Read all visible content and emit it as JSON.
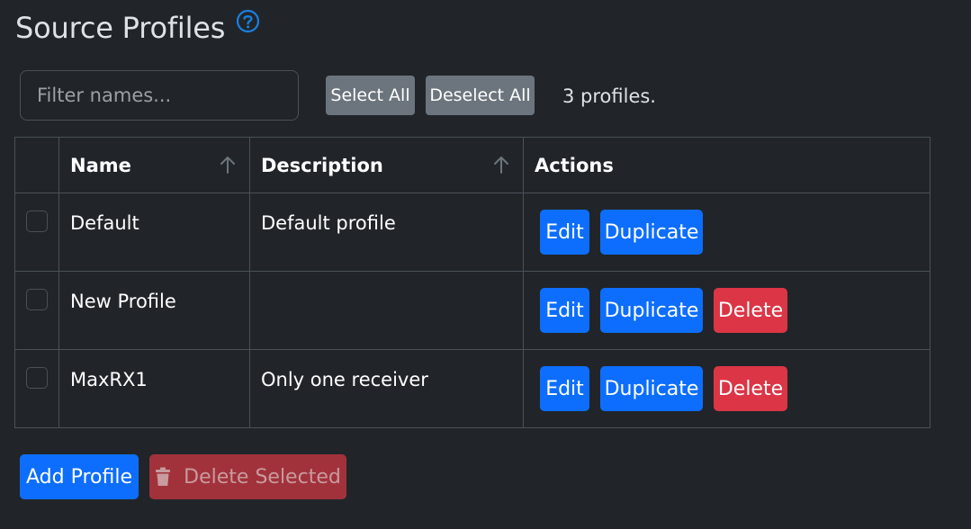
{
  "header": {
    "title": "Source Profiles",
    "help_icon": "question-circle-icon"
  },
  "toolbar": {
    "filter_placeholder": "Filter names...",
    "filter_value": "",
    "select_all_label": "Select All",
    "deselect_all_label": "Deselect All",
    "count_text": "3 profiles."
  },
  "table": {
    "columns": [
      {
        "label": "",
        "sortable": false
      },
      {
        "label": "Name",
        "sortable": true,
        "sort_icon": "arrow-up-icon"
      },
      {
        "label": "Description",
        "sortable": true,
        "sort_icon": "arrow-up-icon"
      },
      {
        "label": "Actions",
        "sortable": false
      }
    ],
    "rows": [
      {
        "checked": false,
        "name": "Default",
        "description": "Default profile",
        "actions": [
          "Edit",
          "Duplicate"
        ]
      },
      {
        "checked": false,
        "name": "New Profile",
        "description": "",
        "actions": [
          "Edit",
          "Duplicate",
          "Delete"
        ]
      },
      {
        "checked": false,
        "name": "MaxRX1",
        "description": "Only one receiver",
        "actions": [
          "Edit",
          "Duplicate",
          "Delete"
        ]
      }
    ]
  },
  "footer": {
    "add_label": "Add Profile",
    "delete_selected_label": "Delete Selected",
    "delete_selected_icon": "trash-icon",
    "delete_selected_disabled": true
  },
  "colors": {
    "background": "#212529",
    "primary": "#0d6efd",
    "danger": "#dc3545",
    "secondary": "#6c757d",
    "border": "#495057"
  }
}
